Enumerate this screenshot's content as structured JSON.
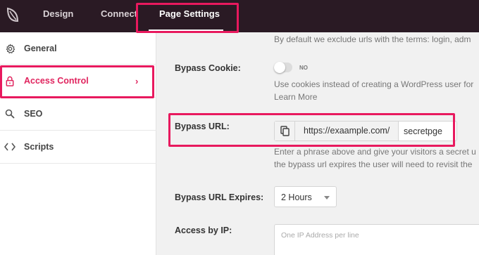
{
  "topbar": {
    "logo_icon": "seedprod-leaf-icon",
    "tabs": [
      {
        "label": "Design"
      },
      {
        "label": "Connect"
      },
      {
        "label": "Page Settings",
        "active": true
      }
    ]
  },
  "sidebar": {
    "items": [
      {
        "label": "General",
        "icon": "gear-icon"
      },
      {
        "label": "Access Control",
        "icon": "lock-icon",
        "active": true
      },
      {
        "label": "SEO",
        "icon": "search-icon"
      },
      {
        "label": "Scripts",
        "icon": "code-icon"
      }
    ]
  },
  "content": {
    "exclude_help": "By default we exclude urls with the terms: login, adm",
    "bypass_cookie": {
      "label": "Bypass Cookie:",
      "toggle_text": "NO",
      "help_line1": "Use cookies instead of creating a WordPress user for",
      "help_line2": "Learn More"
    },
    "bypass_url": {
      "label": "Bypass URL:",
      "copy_icon": "copy-icon",
      "prefix": "https://exaample.com/",
      "value": "secretpge",
      "help_line1": "Enter a phrase above and give your visitors a secret u",
      "help_line2": "the bypass url expires the user will need to revisit the"
    },
    "bypass_url_expires": {
      "label": "Bypass URL Expires:",
      "value": "2 Hours"
    },
    "access_by_ip": {
      "label": "Access by IP:",
      "placeholder": "One IP Address per line"
    }
  },
  "colors": {
    "accent": "#e0245e",
    "highlight": "#e8195e",
    "topbar_bg": "#2a1a24"
  }
}
